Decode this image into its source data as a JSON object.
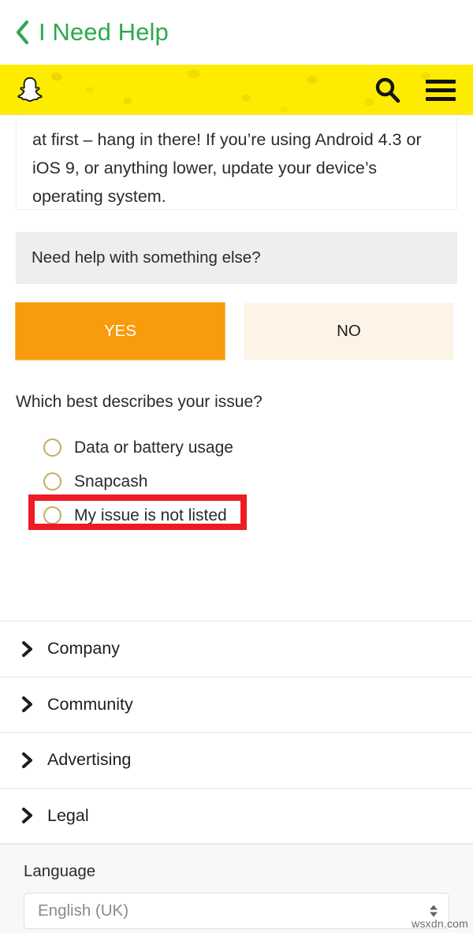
{
  "header": {
    "back_icon": "chevron-left-icon",
    "title": "I Need Help",
    "title_color": "#2fa84f"
  },
  "snap_bar": {
    "background_color": "#fdec00",
    "logo_icon": "snapchat-ghost-icon",
    "search_icon": "search-icon",
    "menu_icon": "hamburger-menu-icon"
  },
  "answer_card": {
    "text": "at first – hang in there! If you’re using Android 4.3 or iOS 9, or anything lower, update your device’s operating system."
  },
  "followup": {
    "prompt": "Need help with something else?",
    "yes_label": "YES",
    "no_label": "NO",
    "yes_color": "#f89b0c",
    "no_color": "#fdf3e7"
  },
  "issue_question": {
    "label": "Which best describes your issue?",
    "radio_color": "#c6ac5c",
    "options": [
      {
        "label": "Data or battery usage",
        "selected": false
      },
      {
        "label": "Snapcash",
        "selected": false
      },
      {
        "label": "My issue is not listed",
        "selected": false
      }
    ],
    "highlighted_option_index": 2,
    "highlight_color": "#ed1b24"
  },
  "footer": {
    "chevron_icon": "chevron-right-icon",
    "items": [
      {
        "label": "Company"
      },
      {
        "label": "Community"
      },
      {
        "label": "Advertising"
      },
      {
        "label": "Legal"
      }
    ]
  },
  "language": {
    "label": "Language",
    "selected": "English (UK)",
    "spinner_icon": "spinner-up-down-icon"
  },
  "watermark": {
    "text": "wsxdn.com"
  }
}
